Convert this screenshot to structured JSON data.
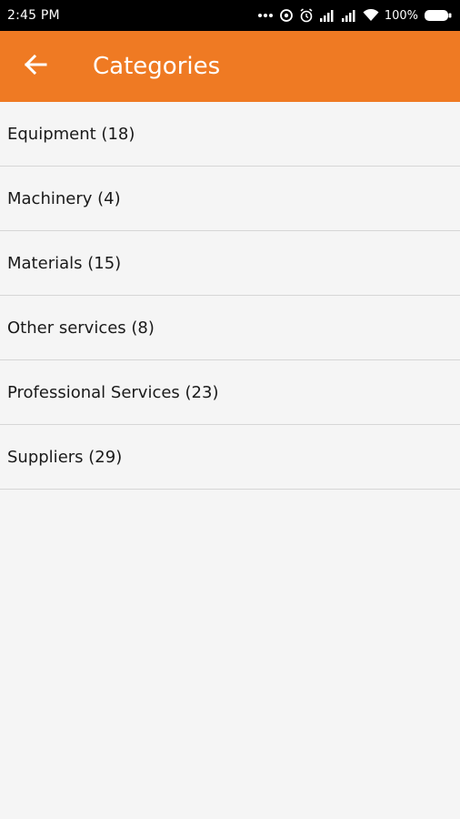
{
  "status_bar": {
    "time": "2:45 PM",
    "battery": "100%",
    "icons": [
      "more-dots-icon",
      "data-saver-icon",
      "alarm-icon",
      "signal-icon",
      "signal-icon",
      "wifi-icon",
      "battery-icon"
    ]
  },
  "app_bar": {
    "title": "Categories",
    "back_icon": "arrow-left-icon",
    "background": "#ef7a23"
  },
  "categories": [
    {
      "label": "Equipment (18)"
    },
    {
      "label": "Machinery (4)"
    },
    {
      "label": "Materials (15)"
    },
    {
      "label": "Other services (8)"
    },
    {
      "label": "Professional Services (23)"
    },
    {
      "label": "Suppliers (29)"
    }
  ]
}
